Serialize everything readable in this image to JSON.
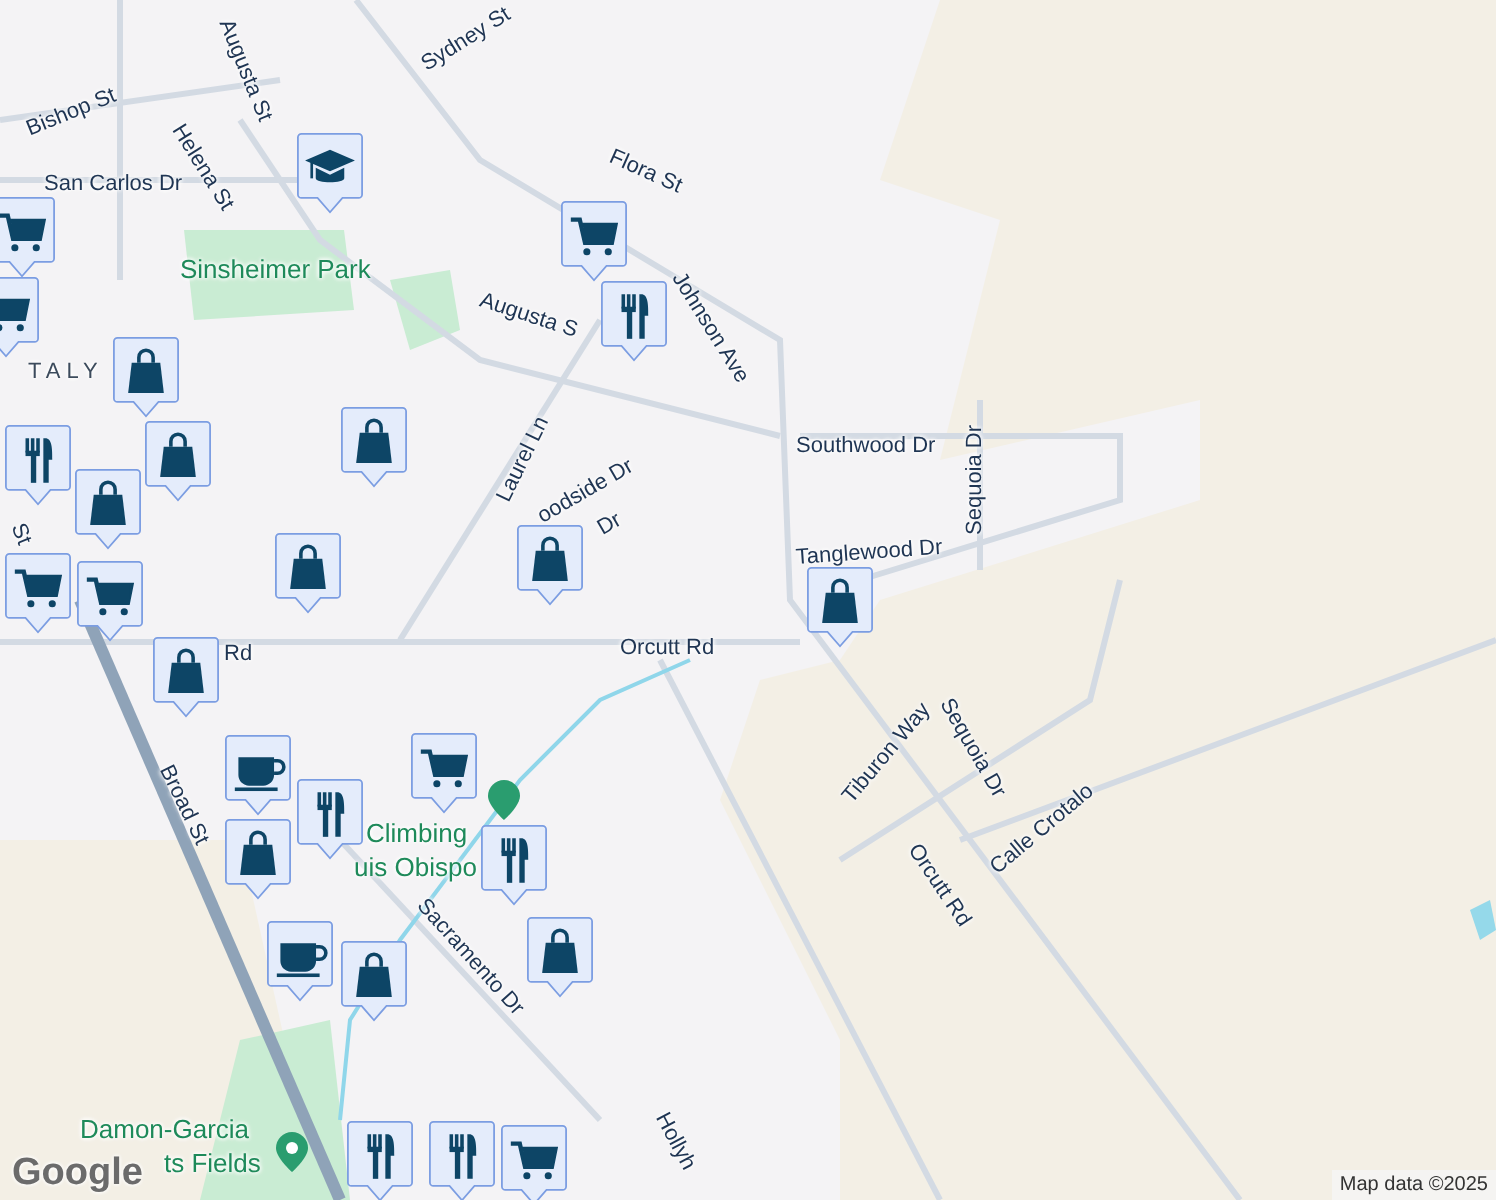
{
  "map": {
    "labels": [
      {
        "text": "Sydney St",
        "kind": "street"
      },
      {
        "text": "Augusta St",
        "kind": "street"
      },
      {
        "text": "Bishop St",
        "kind": "street"
      },
      {
        "text": "Helena St",
        "kind": "street"
      },
      {
        "text": "San Carlos Dr",
        "kind": "street"
      },
      {
        "text": "Flora St",
        "kind": "street"
      },
      {
        "text": "Johnson Ave",
        "kind": "street"
      },
      {
        "text": "Sinsheimer Park",
        "kind": "park"
      },
      {
        "text": "Augusta S",
        "kind": "street"
      },
      {
        "text": "TALY",
        "kind": "area"
      },
      {
        "text": "Laurel Ln",
        "kind": "street"
      },
      {
        "text": "Southwood Dr",
        "kind": "street"
      },
      {
        "text": "Sequoia Dr",
        "kind": "street"
      },
      {
        "text": "oodside Dr",
        "kind": "street"
      },
      {
        "text": "Dr",
        "kind": "street"
      },
      {
        "text": "Tanglewood Dr",
        "kind": "street"
      },
      {
        "text": "Orcutt Rd",
        "kind": "street"
      },
      {
        "text": "Rd",
        "kind": "street"
      },
      {
        "text": "St",
        "kind": "street"
      },
      {
        "text": "Broad St",
        "kind": "street"
      },
      {
        "text": "Climbing",
        "kind": "park"
      },
      {
        "text": "uis Obispo",
        "kind": "park"
      },
      {
        "text": "Sacramento Dr",
        "kind": "street"
      },
      {
        "text": "Tiburon Way",
        "kind": "street"
      },
      {
        "text": "Sequoia Dr",
        "kind": "street"
      },
      {
        "text": "Calle Crotalo",
        "kind": "street"
      },
      {
        "text": "Orcutt Rd",
        "kind": "street"
      },
      {
        "text": "Damon-Garcia",
        "kind": "park"
      },
      {
        "text": "ts Fields",
        "kind": "park"
      },
      {
        "text": "Hollyh",
        "kind": "street"
      }
    ],
    "pins": [
      {
        "kind": "school"
      },
      {
        "kind": "grocery"
      },
      {
        "kind": "grocery"
      },
      {
        "kind": "restaurant"
      },
      {
        "kind": "grocery"
      },
      {
        "kind": "shopping"
      },
      {
        "kind": "restaurant"
      },
      {
        "kind": "shopping"
      },
      {
        "kind": "shopping"
      },
      {
        "kind": "shopping"
      },
      {
        "kind": "shopping"
      },
      {
        "kind": "shopping"
      },
      {
        "kind": "shopping"
      },
      {
        "kind": "grocery"
      },
      {
        "kind": "grocery"
      },
      {
        "kind": "shopping"
      },
      {
        "kind": "cafe"
      },
      {
        "kind": "restaurant"
      },
      {
        "kind": "shopping"
      },
      {
        "kind": "grocery"
      },
      {
        "kind": "restaurant"
      },
      {
        "kind": "shopping"
      },
      {
        "kind": "cafe"
      },
      {
        "kind": "shopping"
      },
      {
        "kind": "restaurant"
      },
      {
        "kind": "restaurant"
      },
      {
        "kind": "grocery"
      }
    ],
    "logo": "Google",
    "attribution": "Map data ©2025"
  }
}
